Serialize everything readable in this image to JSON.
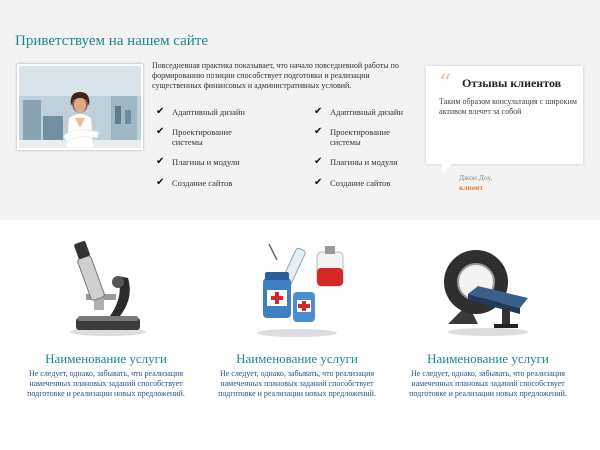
{
  "welcome": {
    "title": "Приветствуем на нашем сайте",
    "intro": "Повседневная практика показывает, что начало повседневной работы по формированию позиции способствует подготовки и реализации существенных финансовых и административных условий."
  },
  "features_left": [
    {
      "label": "Адаптивный дизайн",
      "icon": "check-icon"
    },
    {
      "label": "Проектирование системы",
      "icon": "check-icon"
    },
    {
      "label": "Плагины и модули",
      "icon": "check-icon"
    },
    {
      "label": "Создание сайтов",
      "icon": "check-icon"
    }
  ],
  "features_right": [
    {
      "label": "Адаптивный дизайн",
      "icon": "check-icon"
    },
    {
      "label": "Проектирование системы",
      "icon": "check-icon"
    },
    {
      "label": "Плагины и модули",
      "icon": "check-icon"
    },
    {
      "label": "Создание сайтов",
      "icon": "check-icon"
    }
  ],
  "testimonial": {
    "quote_mark": "“",
    "title": "Отзывы клиентов",
    "text": "Таким образом консультация с широким активом влечет за собой",
    "author": "Джон Доу,",
    "role": "клиент"
  },
  "services": [
    {
      "icon": "microscope-icon",
      "title": "Наименование услуги",
      "text": "Не следует, однако, забывать, что реализация намеченных плановых заданий способствует подготовке и реализации новых предложений."
    },
    {
      "icon": "medicine-syringe-icon",
      "title": "Наименование услуги",
      "text": "Не следует, однако, забывать, что реализация намеченных плановых заданий способствует подготовке и реализации новых предложений."
    },
    {
      "icon": "mri-scanner-icon",
      "title": "Наименование услуги",
      "text": "Не следует, однако, забывать, что реализация намеченных плановых заданий способствует подготовке и реализации новых предложений."
    }
  ],
  "colors": {
    "accent": "#1a8a8a",
    "service_text": "#2a4f8f",
    "author_role": "#e07b3a",
    "band": "#f3f3f3"
  }
}
